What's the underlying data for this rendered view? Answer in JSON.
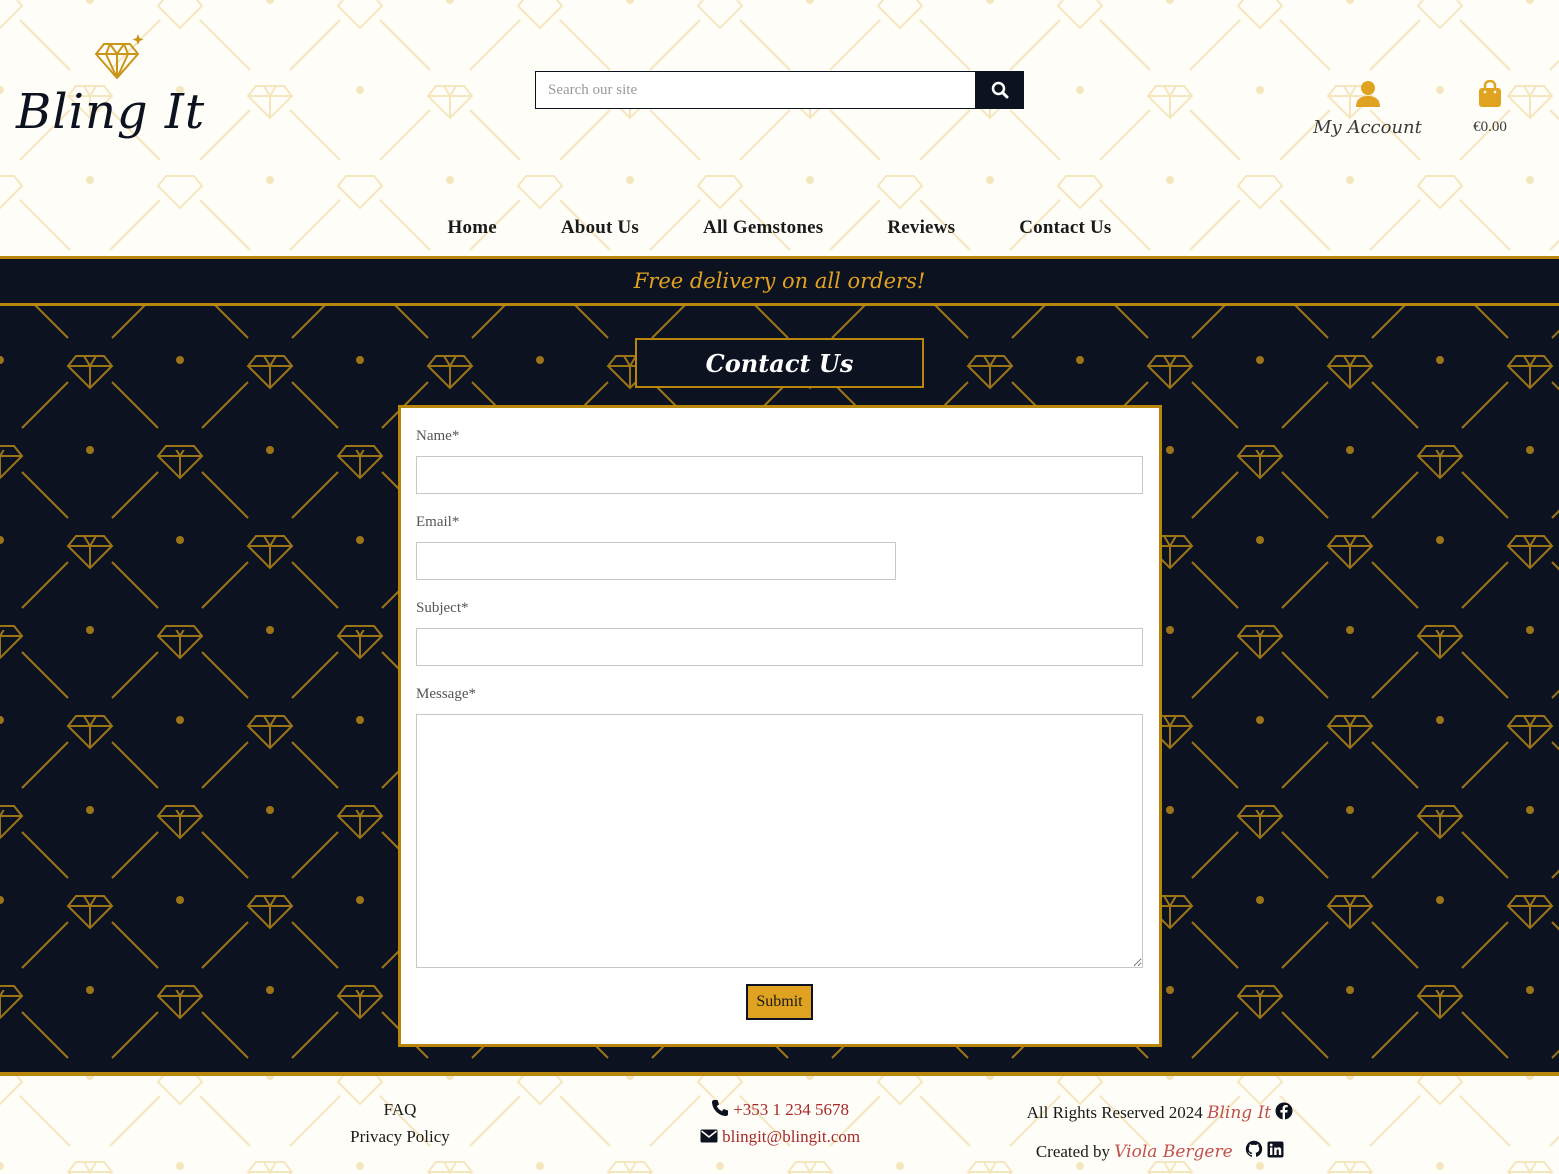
{
  "brand": {
    "name": "Bling It"
  },
  "search": {
    "placeholder": "Search our site"
  },
  "account": {
    "label": "My Account",
    "icon": "user-icon"
  },
  "bag": {
    "total": "€0.00",
    "icon": "shopping-bag-icon"
  },
  "nav": {
    "items": [
      {
        "label": "Home"
      },
      {
        "label": "About Us"
      },
      {
        "label": "All Gemstones"
      },
      {
        "label": "Reviews"
      },
      {
        "label": "Contact Us"
      }
    ]
  },
  "banner": {
    "text": "Free delivery on all orders!"
  },
  "page": {
    "title": "Contact Us"
  },
  "form": {
    "name_label": "Name*",
    "email_label": "Email*",
    "subject_label": "Subject*",
    "message_label": "Message*",
    "name_value": "",
    "email_value": "",
    "subject_value": "",
    "message_value": "",
    "submit_label": "Submit"
  },
  "footer": {
    "faq": "FAQ",
    "privacy": "Privacy Policy",
    "phone": "+353 1 234 5678",
    "email": "blingit@blingit.com",
    "rights": "All Rights Reserved 2024",
    "brand": "Bling It",
    "created_by": "Created by",
    "author": "Viola Bergere"
  },
  "colors": {
    "navy": "#0c1220",
    "gold": "#b8860b",
    "gold_light": "#e0a321",
    "accent_red": "#a52a2a"
  }
}
